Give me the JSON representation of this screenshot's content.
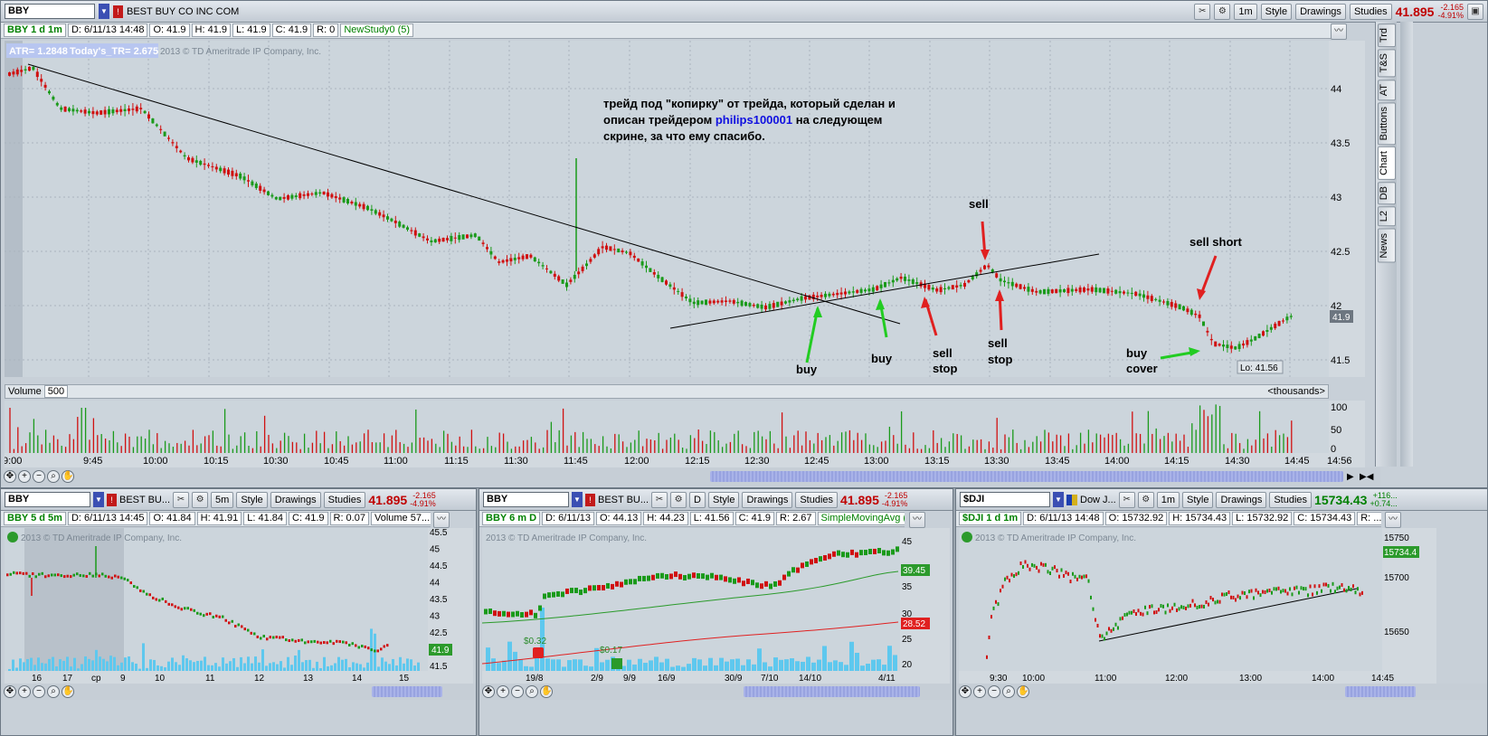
{
  "main": {
    "symbol": "BBY",
    "company": "BEST BUY CO INC COM",
    "toolbar": {
      "timeframe": "1m",
      "style": "Style",
      "drawings": "Drawings",
      "studies": "Studies",
      "last": "41.895",
      "chg": "-2.165",
      "chg_pct": "-4.91%"
    },
    "info": {
      "title": "BBY 1 d 1m",
      "date": "D: 6/11/13 14:48",
      "open": "O: 41.9",
      "high": "H: 41.9",
      "low": "L: 41.9",
      "close": "C: 41.9",
      "range": "R: 0",
      "study": "NewStudy0 (5)"
    },
    "atr": "ATR= 1.2848",
    "today_tr": "Today's_TR= 2.675",
    "copyright": "2013 © TD Ameritrade IP Company, Inc.",
    "annotation": [
      "трейд под \"копирку\" от трейда, который сделан и",
      "описан трейдером ",
      "philips100001",
      " на следующем",
      "скрине, за что ему спасибо."
    ],
    "labels": {
      "sell": "sell",
      "sell_short": "sell short",
      "buy1": "buy",
      "buy2": "buy",
      "sell_stop1": [
        "sell",
        "stop"
      ],
      "sell_stop2": [
        "sell",
        "stop"
      ],
      "buy_cover": [
        "buy",
        "cover"
      ]
    },
    "price_ticks": [
      "44",
      "43.5",
      "43",
      "42.5",
      "42",
      "41.5"
    ],
    "last_price_tag": "41.9",
    "lo_tag": "Lo: 41.56",
    "volume_label": "Volume",
    "volume_value": "500",
    "thousands": "<thousands>",
    "volume_ticks": [
      "100",
      "50",
      "0"
    ],
    "time_ticks": [
      "9:00",
      "9:45",
      "10:00",
      "10:15",
      "10:30",
      "10:45",
      "11:00",
      "11:15",
      "11:30",
      "11:45",
      "12:00",
      "12:15",
      "12:30",
      "12:45",
      "13:00",
      "13:15",
      "13:30",
      "13:45",
      "14:00",
      "14:15",
      "14:30",
      "14:45",
      "14:56"
    ]
  },
  "sidebar": [
    "Trd",
    "T&S",
    "AT",
    "Buttons",
    "Chart",
    "DB",
    "L2",
    "News"
  ],
  "sub1": {
    "symbol": "BBY",
    "company": "BEST BU...",
    "timeframe": "5m",
    "style": "Style",
    "drawings": "Drawings",
    "studies": "Studies",
    "last": "41.895",
    "chg": "-2.165",
    "chg_pct": "-4.91%",
    "info": [
      "BBY 5 d 5m",
      "D: 6/11/13 14:45",
      "O: 41.84",
      "H: 41.91",
      "L: 41.84",
      "C: 41.9",
      "R: 0.07",
      "Volume 57..."
    ],
    "copyright": "2013 © TD Ameritrade IP Company, Inc.",
    "price_ticks": [
      "45.5",
      "45",
      "44.5",
      "44",
      "43.5",
      "43",
      "42.5",
      "42",
      "41.5"
    ],
    "tag": "41.9",
    "time_ticks": [
      "16",
      "17",
      "cp",
      "9",
      "10",
      "11",
      "12",
      "13",
      "14",
      "15"
    ]
  },
  "sub2": {
    "symbol": "BBY",
    "company": "BEST BU...",
    "timeframe": "D",
    "style": "Style",
    "drawings": "Drawings",
    "studies": "Studies",
    "last": "41.895",
    "chg": "-2.165",
    "chg_pct": "-4.91%",
    "info": [
      "BBY 6 m D",
      "D: 6/11/13",
      "O: 44.13",
      "H: 44.23",
      "L: 41.56",
      "C: 41.9",
      "R: 2.67",
      "SimpleMovingAvg (..."
    ],
    "copyright": "2013 © TD Ameritrade IP Company, Inc.",
    "price_ticks": [
      "45",
      "35",
      "30",
      "25",
      "20"
    ],
    "tag_green": "39.45",
    "tag_red": "28.52",
    "div1": "$0.32",
    "div2": "$0.17",
    "time_ticks": [
      "19/8",
      "2/9",
      "9/9",
      "16/9",
      "30/9",
      "7/10",
      "14/10",
      "4/11"
    ]
  },
  "sub3": {
    "symbol": "$DJI",
    "company": "Dow J...",
    "timeframe": "1m",
    "style": "Style",
    "drawings": "Drawings",
    "studies": "Studies",
    "last": "15734.43",
    "chg": "+116...",
    "chg_pct": "+0.74...",
    "info": [
      "$DJI 1 d 1m",
      "D: 6/11/13 14:48",
      "O: 15732.92",
      "H: 15734.43",
      "L: 15732.92",
      "C: 15734.43",
      "R: ..."
    ],
    "copyright": "2013 © TD Ameritrade IP Company, Inc.",
    "price_ticks": [
      "15750",
      "15700",
      "15650"
    ],
    "tag": "15734.4",
    "time_ticks": [
      "9:30",
      "10:00",
      "11:00",
      "12:00",
      "13:00",
      "14:00",
      "14:45"
    ]
  }
}
